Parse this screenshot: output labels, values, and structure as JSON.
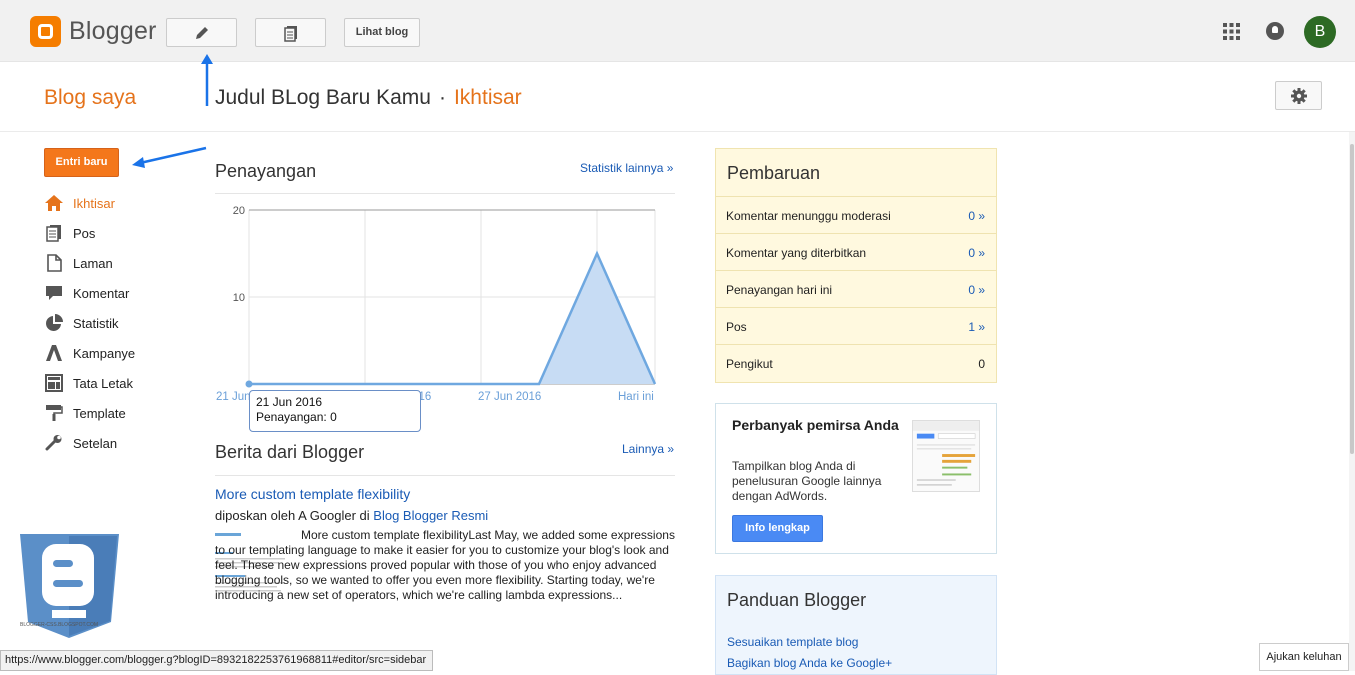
{
  "topbar": {
    "logo_text": "Blogger",
    "view_blog_label": "Lihat blog",
    "avatar_letter": "B"
  },
  "header": {
    "my_blogs": "Blog saya",
    "blog_title": "Judul BLog Baru Kamu",
    "separator": "·",
    "section": "Ikhtisar"
  },
  "sidebar": {
    "new_post": "Entri baru",
    "items": [
      {
        "label": "Ikhtisar",
        "icon": "home-icon",
        "active": true
      },
      {
        "label": "Pos",
        "icon": "posts-icon"
      },
      {
        "label": "Laman",
        "icon": "page-icon"
      },
      {
        "label": "Komentar",
        "icon": "comment-icon"
      },
      {
        "label": "Statistik",
        "icon": "pie-icon"
      },
      {
        "label": "Kampanye",
        "icon": "adwords-icon"
      },
      {
        "label": "Tata Letak",
        "icon": "layout-icon"
      },
      {
        "label": "Template",
        "icon": "paint-roller-icon"
      },
      {
        "label": "Setelan",
        "icon": "wrench-icon"
      }
    ]
  },
  "views": {
    "heading": "Penayangan",
    "more_link": "Statistik lainnya »",
    "tooltip_date": "21 Jun 2016",
    "tooltip_value": "Penayangan: 0"
  },
  "chart_data": {
    "type": "area",
    "categories": [
      "21 Jun 2016",
      "23 Jun 2016",
      "25 Jun 2016",
      "27 Jun 2016",
      "Hari ini"
    ],
    "x": [
      0,
      1,
      2,
      3,
      4,
      5,
      6,
      7
    ],
    "series": [
      {
        "values": [
          0,
          0,
          0,
          0,
          0,
          0,
          15,
          0
        ]
      }
    ],
    "ylim": [
      0,
      20
    ],
    "yticks": [
      10,
      20
    ],
    "xticklabels": [
      "21 Jun",
      "25 Jun 2016",
      "27 Jun 2016",
      "Hari ini"
    ],
    "grid": true,
    "color": "#6fa8e0"
  },
  "news": {
    "heading": "Berita dari Blogger",
    "more_link": "Lainnya »",
    "title": "More custom template flexibility",
    "meta_prefix": "diposkan oleh A Googler di",
    "meta_blog": "Blog Blogger Resmi",
    "body": "More custom template flexibilityLast May, we added some expressions to our templating language to make it easier for you to customize your blog's look and feel. These new expressions proved popular with those of you who enjoy advanced blogging tools, so we wanted to offer you even more flexibility.  Starting today, we're introducing a new set of operators, which we're calling lambda expressions..."
  },
  "updates": {
    "heading": "Pembaruan",
    "rows": [
      {
        "label": "Komentar menunggu moderasi",
        "value": "0 »",
        "link": true
      },
      {
        "label": "Komentar yang diterbitkan",
        "value": "0 »",
        "link": true
      },
      {
        "label": "Penayangan hari ini",
        "value": "0 »",
        "link": true
      },
      {
        "label": "Pos",
        "value": "1 »",
        "link": true
      },
      {
        "label": "Pengikut",
        "value": "0",
        "link": false
      }
    ]
  },
  "promo": {
    "heading": "Perbanyak pemirsa Anda",
    "text": "Tampilkan blog Anda di penelusuran Google lainnya dengan AdWords.",
    "button": "Info lengkap"
  },
  "guide": {
    "heading": "Panduan Blogger",
    "links": [
      "Sesuaikan template blog",
      "Bagikan blog Anda ke Google+"
    ]
  },
  "watermark": {
    "text": "BLOGGER-CSS.BLOGSPOT.COM"
  },
  "statusbar": {
    "url": "https://www.blogger.com/blogger.g?blogID=8932182253761968811#editor/src=sidebar"
  },
  "feedback": {
    "label": "Ajukan keluhan"
  },
  "colors": {
    "accent": "#e5731b",
    "link": "#1a5bb5",
    "button_orange": "#f4771b",
    "button_blue": "#4a8af4",
    "annotation_arrow": "#1a73e8"
  }
}
